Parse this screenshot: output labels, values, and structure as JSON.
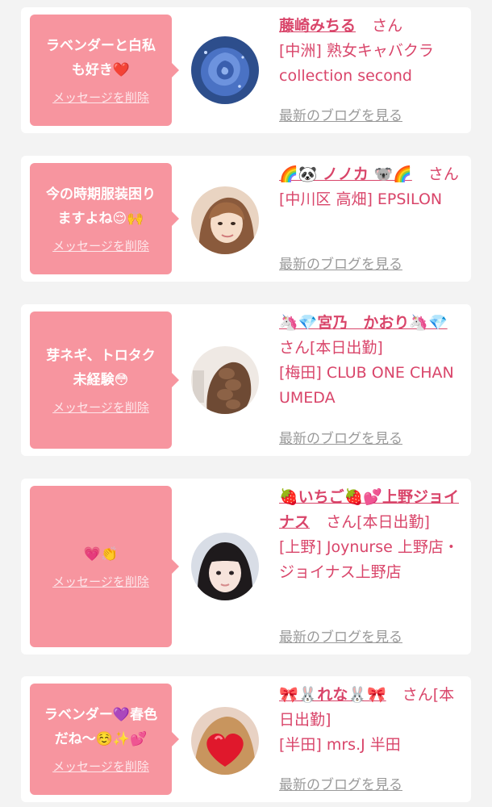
{
  "entries": [
    {
      "message": "ラベンダーと白私\nも好き❤️",
      "delete_label": "メッセージを削除",
      "name": "藤崎みちる",
      "honorific": "さん",
      "shop": "[中洲] 熟女キャバクラ collection second",
      "blog_label": "最新のブログを見る",
      "avatar": "blue-rose"
    },
    {
      "message": "今の時期服装困り\nますよね😌🙌",
      "delete_label": "メッセージを削除",
      "name": "🌈🐼 ノノカ 🐨🌈",
      "honorific": "さん",
      "shop": "[中川区 高畑] EPSILON",
      "blog_label": "最新のブログを見る",
      "avatar": "woman-selfie"
    },
    {
      "message": "芽ネギ、トロタク\n未経験😳",
      "delete_label": "メッセージを削除",
      "name": "🦄💎宮乃　かおり🦄💎",
      "honorific": "さん[本日出勤]",
      "shop": "[梅田] CLUB ONE CHAN UMEDA",
      "blog_label": "最新のブログを見る",
      "avatar": "braided-hair"
    },
    {
      "message": "💗👏",
      "delete_label": "メッセージを削除",
      "name": "🍓いちご🍓💕上野ジョイナス",
      "honorific": "さん[本日出勤]",
      "shop": "[上野] Joynurse 上野店・ジョイナス上野店",
      "blog_label": "最新のブログを見る",
      "avatar": "woman-bangs"
    },
    {
      "message": "ラベンダー💜春色\nだね〜☺️✨💕",
      "delete_label": "メッセージを削除",
      "name": "🎀🐰れな🐰🎀",
      "honorific": "さん[本日出勤]",
      "shop": "[半田] mrs.J 半田",
      "blog_label": "最新のブログを見る",
      "avatar": "heart-photo"
    }
  ],
  "colors": {
    "bubble": "#f7959f",
    "accent_text": "#d9456a",
    "link_gray": "#9a9a9a",
    "background": "#f3f3f3"
  }
}
